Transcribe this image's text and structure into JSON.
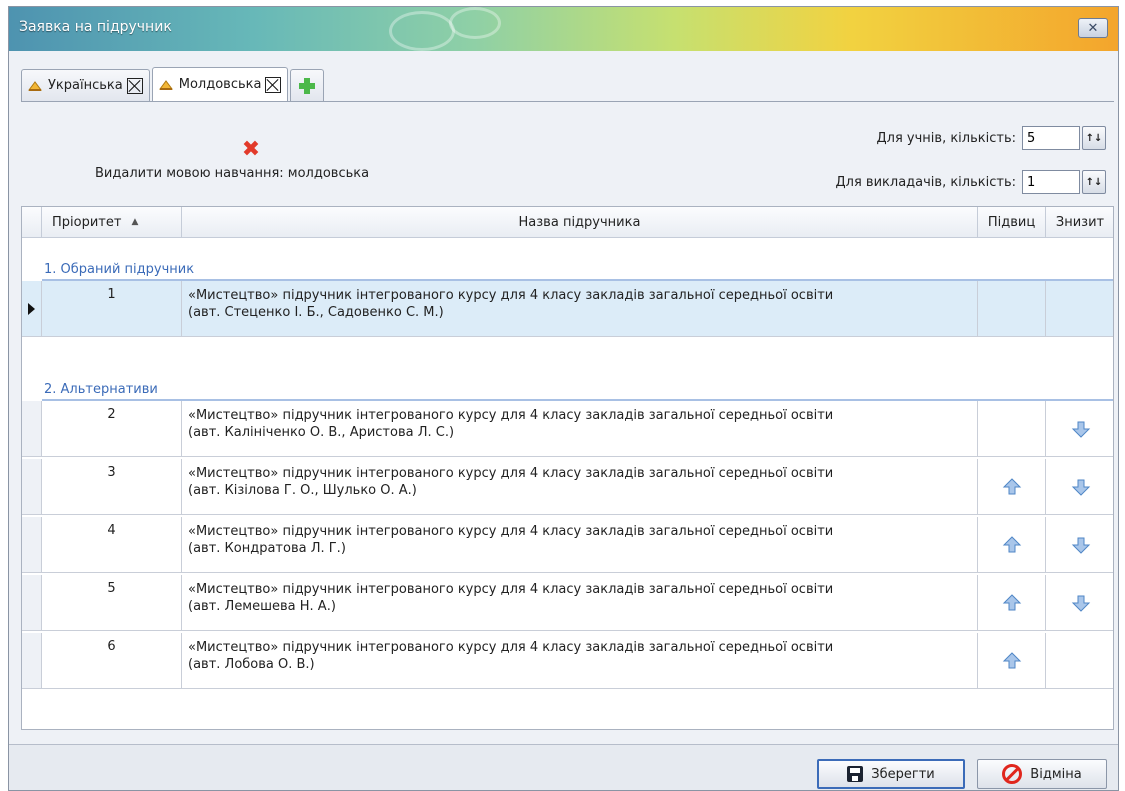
{
  "window": {
    "title": "Заявка на підручник",
    "close_glyph": "✕"
  },
  "tabs": [
    {
      "label": "Українська",
      "active": false
    },
    {
      "label": "Молдовська",
      "active": true
    }
  ],
  "panel": {
    "delete_text": "Видалити мовою навчання: молдовська",
    "students_label": "Для учнів, кількість:",
    "students_value": "5",
    "teachers_label": "Для викладачів, кількість:",
    "teachers_value": "1"
  },
  "grid": {
    "columns": {
      "priority": "Пріоритет",
      "name": "Назва підручника",
      "up": "Підвиц",
      "down": "Знизит"
    },
    "groups": [
      {
        "label": "1. Обраний підручник",
        "rows": [
          {
            "priority": "1",
            "line1": "«Мистецтво» підручник інтегрованого курсу для 4 класу закладів загальної середньої освіти",
            "line2": "(авт. Стеценко І. Б., Садовенко С. М.)",
            "up": false,
            "down": false,
            "selected": true
          }
        ]
      },
      {
        "label": "2. Альтернативи",
        "rows": [
          {
            "priority": "2",
            "line1": "«Мистецтво» підручник інтегрованого курсу для 4 класу закладів загальної середньої освіти",
            "line2": "(авт. Калініченко О. В., Аристова Л. С.)",
            "up": false,
            "down": true
          },
          {
            "priority": "3",
            "line1": "«Мистецтво» підручник інтегрованого курсу для 4 класу закладів загальної середньої освіти",
            "line2": "(авт. Кізілова Г. О., Шулько О. А.)",
            "up": true,
            "down": true
          },
          {
            "priority": "4",
            "line1": "«Мистецтво» підручник інтегрованого курсу для 4 класу закладів загальної середньої освіти",
            "line2": "(авт. Кондратова Л. Г.)",
            "up": true,
            "down": true
          },
          {
            "priority": "5",
            "line1": "«Мистецтво» підручник інтегрованого курсу для 4 класу закладів загальної середньої освіти",
            "line2": "(авт. Лемешева Н. А.)",
            "up": true,
            "down": true
          },
          {
            "priority": "6",
            "line1": "«Мистецтво» підручник інтегрованого курсу для 4 класу закладів загальної середньої освіти",
            "line2": "(авт. Лобова О. В.)",
            "up": true,
            "down": false
          }
        ]
      }
    ]
  },
  "footer": {
    "save_label": "Зберегти",
    "cancel_label": "Відміна"
  },
  "colors": {
    "accent": "#3b6bb8",
    "selected_row": "#dcecf8",
    "arrow_fill": "#a9c6ea",
    "arrow_stroke": "#4f86c6",
    "delete_red": "#e23a2a"
  }
}
